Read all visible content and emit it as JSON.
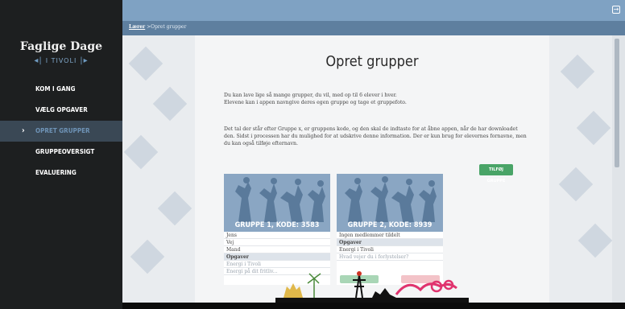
{
  "sidebar": {
    "logo_title": "Faglige Dage",
    "logo_subtitle": "I TIVOLI",
    "items": [
      {
        "label": "KOM I GANG",
        "active": false
      },
      {
        "label": "VÆLG OPGAVER",
        "active": false
      },
      {
        "label": "OPRET GRUPPER",
        "active": true
      },
      {
        "label": "GRUPPEOVERSIGT",
        "active": false
      },
      {
        "label": "EVALUERING",
        "active": false
      }
    ]
  },
  "breadcrumb": {
    "root": "Lærer",
    "separator": ">",
    "current": "Opret grupper"
  },
  "page": {
    "title": "Opret grupper",
    "intro": "Du kan lave lige så mange grupper, du vil, med op til 6 elever i hver.",
    "intro2": "Elevene kan i appen navngive deres egen gruppe og tage et gruppefoto.",
    "info": "Det tal der står efter Gruppe x, er gruppens kode, og den skal de indtaste for at åbne appen, når de har downloadet den. Sidst i processen har du mulighed for at udskrive denne information. Der er kun brug for elevernes fornavne, men du kan også tilføje efternavn.",
    "add_button": "TILFØJ GRUPPE"
  },
  "groups": [
    {
      "title": "GRUPPE 1, KODE: 3583",
      "members": [
        "Jens",
        "Vej",
        "Mand"
      ],
      "tasks_header": "Opgaver",
      "tasks": [
        "Energi i Tivoli",
        "Energi på dit fritliv..."
      ]
    },
    {
      "title": "GRUPPE 2, KODE: 8939",
      "members": [
        "Ingen medlemmer tildelt"
      ],
      "tasks_header": "Opgaver",
      "tasks": [
        "Energi i Tivoli",
        "Hvad vejer du i forlystelser?"
      ]
    }
  ],
  "colors": {
    "sidebar": "#1d1f20",
    "topbar": "#7fa2c3",
    "accent": "#49a467",
    "active_nav": "#3a4855"
  }
}
